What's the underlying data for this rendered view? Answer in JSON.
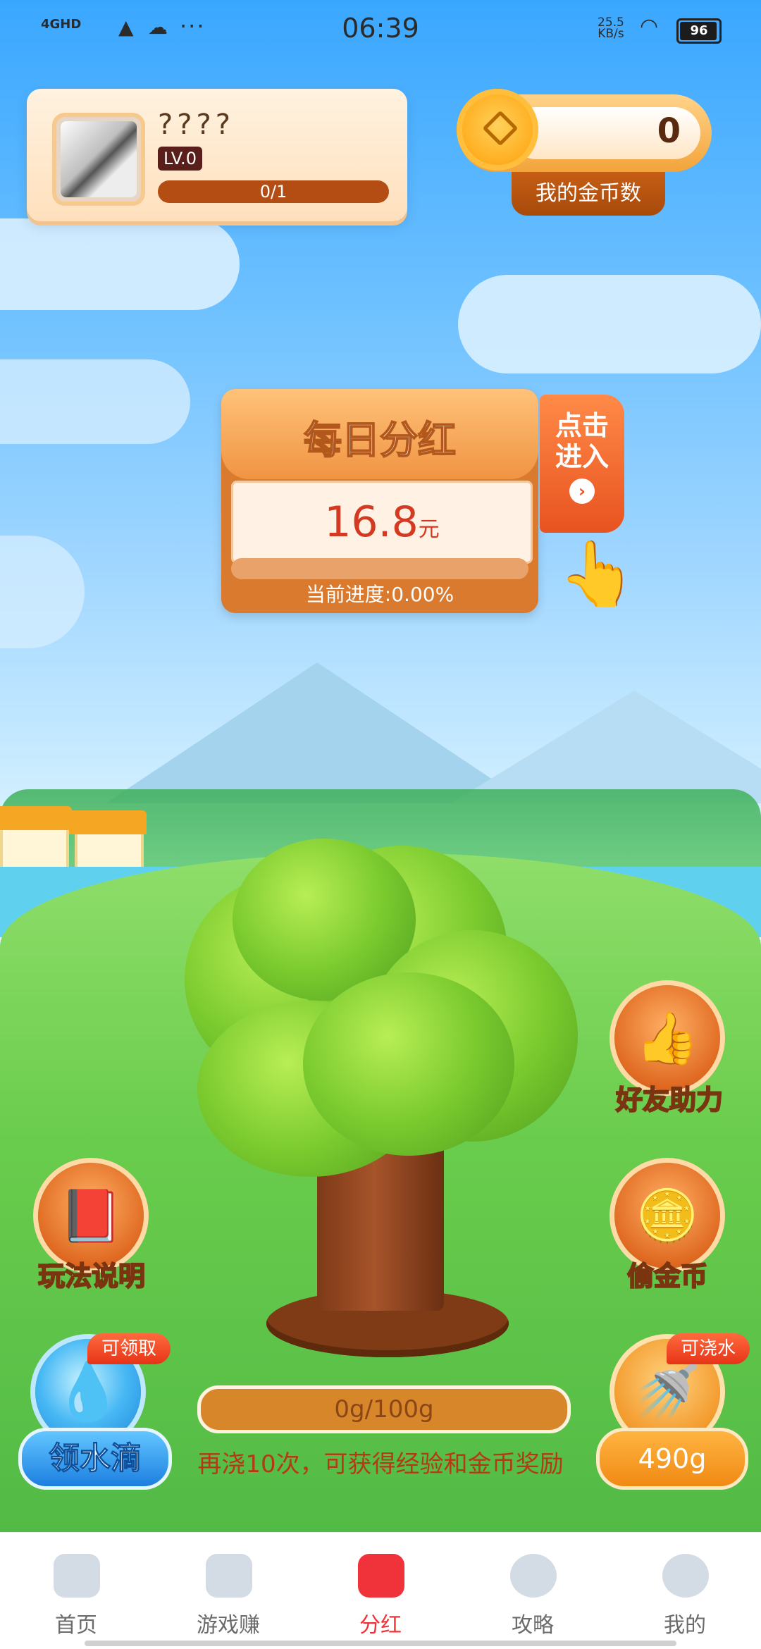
{
  "status_bar": {
    "network": "4GHD",
    "time": "06:39",
    "speed_value": "25.5",
    "speed_unit": "KB/s",
    "battery": "96"
  },
  "profile": {
    "name": "????",
    "level": "LV.0",
    "progress": "0/1"
  },
  "coins": {
    "value": "0",
    "label": "我的金币数"
  },
  "bonus": {
    "title": "每日分红",
    "amount": "16.8",
    "unit": "元",
    "progress_text": "当前进度:0.00%",
    "progress_fraction": 0.0,
    "enter_line1": "点击",
    "enter_line2": "进入"
  },
  "actions": {
    "friends": "好友助力",
    "rules": "玩法说明",
    "steal": "偷金币",
    "water_drop": "领水滴",
    "water_drop_tag": "可领取",
    "watering_tag": "可浇水",
    "watering_amount": "490g"
  },
  "water": {
    "progress": "0g/100g",
    "hint": "再浇10次，可获得经验和金币奖励"
  },
  "nav": [
    {
      "label": "首页",
      "icon": "home-icon"
    },
    {
      "label": "游戏赚",
      "icon": "gamepad-icon"
    },
    {
      "label": "分红",
      "icon": "bonus-icon"
    },
    {
      "label": "攻略",
      "icon": "clock-icon"
    },
    {
      "label": "我的",
      "icon": "profile-icon"
    }
  ],
  "colors": {
    "accent": "#f0333a",
    "coin_label_bg": "#b34d14",
    "hint_text": "#b43a16"
  }
}
